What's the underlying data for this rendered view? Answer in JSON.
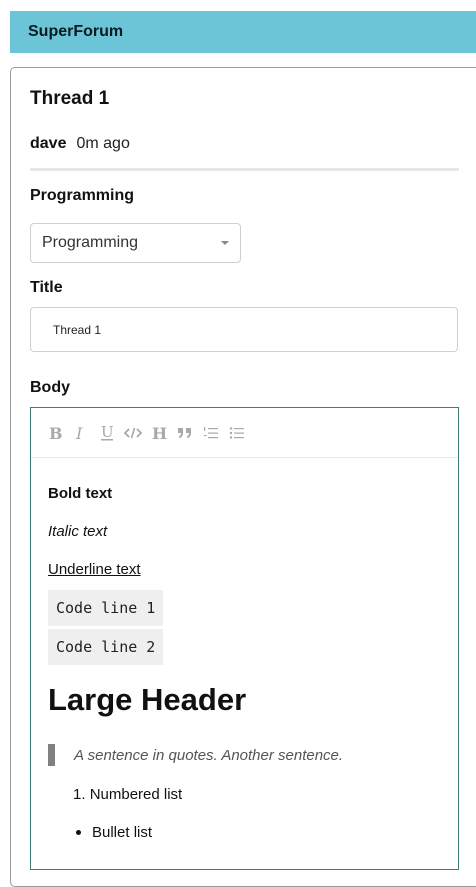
{
  "app": {
    "brand": "SuperForum"
  },
  "thread": {
    "title": "Thread 1",
    "author": "dave",
    "time": "0m ago"
  },
  "category": {
    "label": "Programming",
    "selected": "Programming"
  },
  "title_field": {
    "label": "Title",
    "value": "Thread 1"
  },
  "body": {
    "label": "Body",
    "toolbar": [
      {
        "name": "bold-button",
        "icon": "bold-icon",
        "glyph": "B"
      },
      {
        "name": "italic-button",
        "icon": "italic-icon",
        "glyph": "I"
      },
      {
        "name": "underline-button",
        "icon": "underline-icon",
        "glyph": "U"
      },
      {
        "name": "code-button",
        "icon": "code-icon",
        "glyph": "</>"
      },
      {
        "name": "heading-button",
        "icon": "heading-icon",
        "glyph": "H"
      },
      {
        "name": "quote-button",
        "icon": "quote-icon",
        "glyph": "❞"
      },
      {
        "name": "numbered-list-button",
        "icon": "numbered-list-icon",
        "glyph": "ol"
      },
      {
        "name": "bullet-list-button",
        "icon": "bullet-list-icon",
        "glyph": "ul"
      }
    ],
    "content": {
      "bold": "Bold text",
      "italic": "Italic text",
      "underline": "Underline text",
      "code1": "Code line 1",
      "code2": "Code line 2",
      "header": "Large Header",
      "quote": "A sentence in quotes. Another sentence.",
      "numbered_marker": "1.",
      "numbered": "Numbered list",
      "bullet": "Bullet list"
    }
  },
  "colors": {
    "topbar": "#6cc5d6",
    "editor_border": "#3f7d7a",
    "toolbar_icon": "#a8a8a8",
    "code_bg": "#efefef"
  }
}
